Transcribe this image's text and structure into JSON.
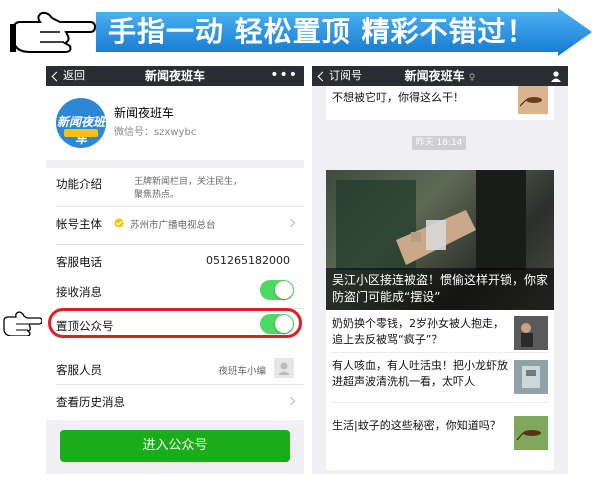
{
  "banner": {
    "text": "手指一动 轻松置顶 精彩不错过！",
    "arrow_color": "#1d8fe0"
  },
  "left_phone": {
    "nav": {
      "back": "返回",
      "title": "新闻夜班车",
      "more": "•••"
    },
    "profile": {
      "name": "新闻夜班车",
      "wechat_id": "微信号：szxwybc",
      "avatar_text": "新闻夜班车"
    },
    "rows": {
      "intro_label": "功能介绍",
      "intro_value": "王牌新闻栏目，关注民生，聚焦热点。",
      "owner_label": "帐号主体",
      "owner_value": "苏州市广播电视总台",
      "phone_label": "客服电话",
      "phone_value": "051265182000",
      "receive_label": "接收消息",
      "pin_label": "置顶公众号",
      "service_label": "客服人员",
      "service_value": "夜班车小编",
      "history_label": "查看历史消息"
    },
    "enter_button": "进入公众号"
  },
  "right_phone": {
    "nav": {
      "back": "订阅号",
      "title": "新闻夜班车"
    },
    "top_snippet": "不想被它叮，你得这么干！",
    "timestamp": "昨天 18:14",
    "headline": "吴江小区接连被盗！惯偷这样开锁，你家防盗门可能成“摆设”",
    "items": [
      {
        "text": "奶奶换个零钱，2岁孙女被人抱走，追上去反被骂“疯子”？"
      },
      {
        "text": "有人咳血，有人吐活虫！把小龙虾放进超声波清洗机一看，太吓人"
      },
      {
        "text": "生活|蚊子的这些秘密，你知道吗？"
      }
    ]
  },
  "colors": {
    "toggle_on": "#4cd964",
    "enter_button": "#1aad19",
    "nav_bar": "#2a2e33",
    "highlight": "#e11e25"
  }
}
